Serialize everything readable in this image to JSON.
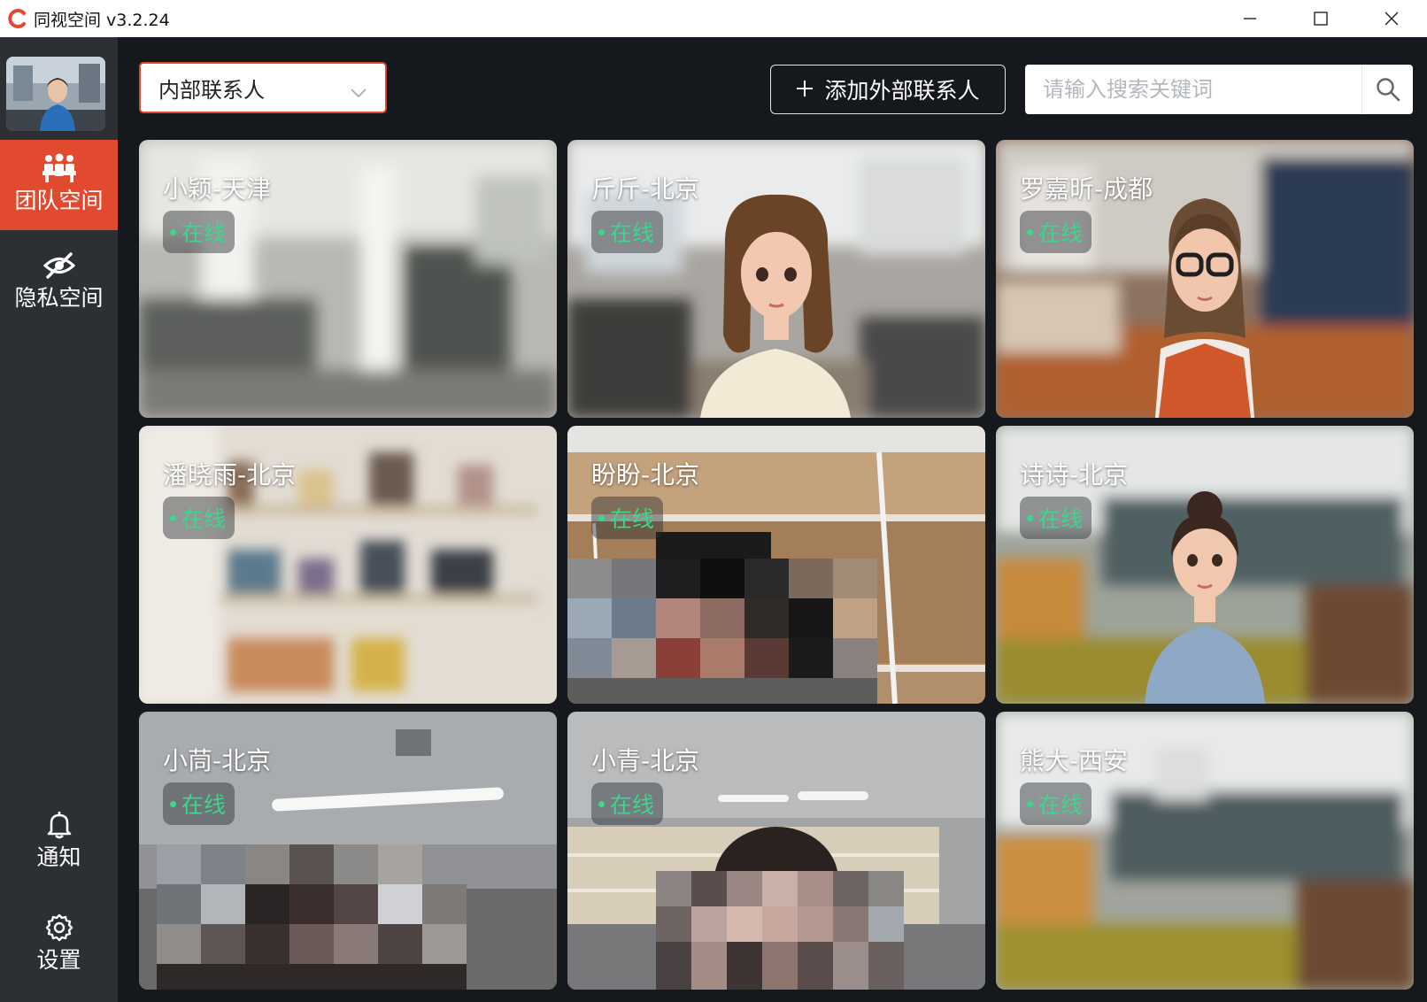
{
  "window": {
    "title": "同视空间 v3.2.24",
    "logo_icon": "brand-c-logo-icon",
    "controls": [
      "minimize-icon",
      "maximize-icon",
      "close-icon"
    ]
  },
  "colors": {
    "accent": "#e24a2f",
    "online": "#3dd68c",
    "sidebar": "#2c2f33",
    "background": "#15181c"
  },
  "sidebar": {
    "items": [
      {
        "label": "团队空间",
        "icon": "team-icon",
        "active": true
      },
      {
        "label": "隐私空间",
        "icon": "eye-off-icon",
        "active": false
      }
    ],
    "bottom": [
      {
        "label": "通知",
        "icon": "bell-icon"
      },
      {
        "label": "设置",
        "icon": "gear-icon"
      }
    ]
  },
  "toolbar": {
    "contact_type": "内部联系人",
    "add_button": "添加外部联系人",
    "search_placeholder": "请输入搜索关键词"
  },
  "contacts": [
    {
      "name": "小颖-天津",
      "status": "在线"
    },
    {
      "name": "斤斤-北京",
      "status": "在线"
    },
    {
      "name": "罗嘉昕-成都",
      "status": "在线"
    },
    {
      "name": "潘晓雨-北京",
      "status": "在线"
    },
    {
      "name": "盼盼-北京",
      "status": "在线"
    },
    {
      "name": "诗诗-北京",
      "status": "在线"
    },
    {
      "name": "小茼-北京",
      "status": "在线"
    },
    {
      "name": "小青-北京",
      "status": "在线"
    },
    {
      "name": "熊大-西安",
      "status": "在线"
    }
  ]
}
